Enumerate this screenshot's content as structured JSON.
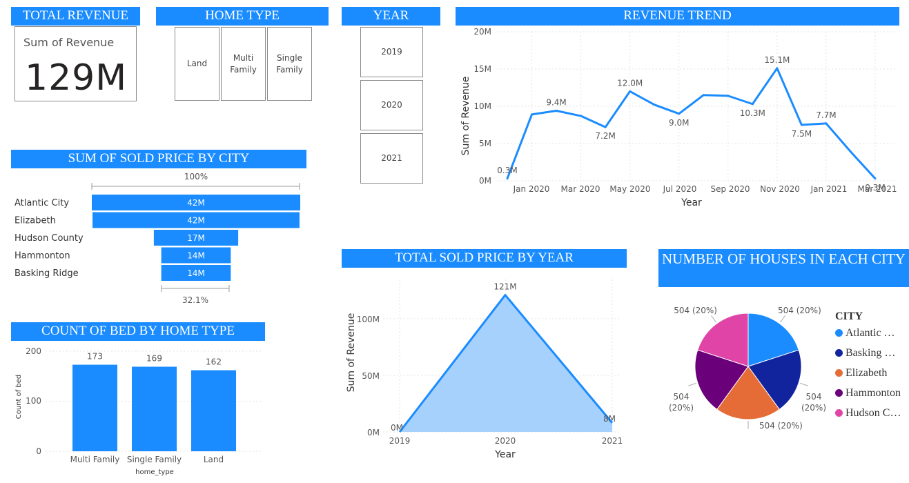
{
  "card": {
    "header": "TOTAL REVENUE",
    "label": "Sum of Revenue",
    "value": "129M"
  },
  "home_type": {
    "header": "HOME TYPE",
    "options": [
      "Land",
      "Multi Family",
      "Single Family"
    ]
  },
  "year_slicer": {
    "header": "YEAR",
    "options": [
      "2019",
      "2020",
      "2021"
    ]
  },
  "revenue_trend": {
    "header": "REVENUE TREND",
    "y_ticks": [
      "20M",
      "15M",
      "10M",
      "5M",
      "0M"
    ],
    "x_ticks": [
      "Jan 2020",
      "Mar 2020",
      "May 2020",
      "Jul 2020",
      "Sep 2020",
      "Nov 2020",
      "Jan 2021",
      "Mar 2021"
    ]
  },
  "funnel": {
    "header": "SUM OF SOLD PRICE BY CITY",
    "top_pct": "100%",
    "bottom_pct": "32.1%"
  },
  "bed_chart": {
    "header": "COUNT OF BED BY HOME TYPE",
    "y_ticks": [
      "200",
      "100",
      "0"
    ]
  },
  "sold_by_year": {
    "header": "TOTAL SOLD PRICE BY YEAR",
    "y_ticks": [
      "100M",
      "50M",
      "0M"
    ]
  },
  "houses_pie": {
    "header": "NUMBER OF HOUSES IN EACH CITY",
    "legend_title": "CITY",
    "legend": [
      "Atlantic …",
      "Basking …",
      "Elizabeth",
      "Hammonton",
      "Hudson C…"
    ]
  },
  "colors": {
    "header_bg": "#1a8cff",
    "accent": "#1a8cff",
    "area_fill": "#a6d1fc"
  },
  "chart_data": [
    {
      "type": "line",
      "title": "REVENUE TREND",
      "xlabel": "Year",
      "ylabel": "Sum of Revenue",
      "ylim": [
        0,
        20
      ],
      "unit": "M",
      "x": [
        "Dec 2019",
        "Jan 2020",
        "Feb 2020",
        "Mar 2020",
        "Apr 2020",
        "May 2020",
        "Jun 2020",
        "Jul 2020",
        "Aug 2020",
        "Sep 2020",
        "Oct 2020",
        "Nov 2020",
        "Dec 2020",
        "Jan 2021",
        "Feb 2021",
        "Mar 2021"
      ],
      "values": [
        0.3,
        8.9,
        9.4,
        8.7,
        7.2,
        12.0,
        10.2,
        9.0,
        11.5,
        11.4,
        10.3,
        15.1,
        7.5,
        7.7,
        3.9,
        0.3
      ],
      "data_labels": [
        {
          "index": 0,
          "text": "0.3M"
        },
        {
          "index": 2,
          "text": "9.4M"
        },
        {
          "index": 4,
          "text": "7.2M"
        },
        {
          "index": 5,
          "text": "12.0M"
        },
        {
          "index": 7,
          "text": "9.0M"
        },
        {
          "index": 10,
          "text": "10.3M"
        },
        {
          "index": 11,
          "text": "15.1M"
        },
        {
          "index": 12,
          "text": "7.5M"
        },
        {
          "index": 13,
          "text": "7.7M"
        },
        {
          "index": 15,
          "text": "0.3M"
        }
      ]
    },
    {
      "type": "bar",
      "subtype": "funnel",
      "title": "SUM OF SOLD PRICE BY CITY",
      "categories": [
        "Atlantic City",
        "Elizabeth",
        "Hudson County",
        "Hammonton",
        "Basking Ridge"
      ],
      "values": [
        42,
        42,
        17,
        14,
        14
      ],
      "labels": [
        "42M",
        "42M",
        "17M",
        "14M",
        "14M"
      ],
      "unit": "M"
    },
    {
      "type": "bar",
      "title": "COUNT OF BED BY HOME TYPE",
      "xlabel": "home_type",
      "ylabel": "Count of bed",
      "categories": [
        "Multi Family",
        "Single Family",
        "Land"
      ],
      "values": [
        173,
        169,
        162
      ],
      "ylim": [
        0,
        200
      ]
    },
    {
      "type": "area",
      "title": "TOTAL SOLD PRICE BY YEAR",
      "xlabel": "Year",
      "ylabel": "Sum of Revenue",
      "x": [
        "2019",
        "2020",
        "2021"
      ],
      "values": [
        0,
        121,
        8
      ],
      "labels": [
        "0M",
        "121M",
        "8M"
      ],
      "unit": "M",
      "ylim": [
        0,
        130
      ]
    },
    {
      "type": "pie",
      "title": "NUMBER OF HOUSES IN EACH CITY",
      "categories": [
        "Atlantic City",
        "Basking Ridge",
        "Elizabeth",
        "Hammonton",
        "Hudson County"
      ],
      "values": [
        504,
        504,
        504,
        504,
        504
      ],
      "labels": [
        "504 (20%)",
        "504 (20%)",
        "504 (20%)",
        "504 (20%)",
        "504 (20%)"
      ],
      "colors": [
        "#1a8cff",
        "#12239e",
        "#e66c37",
        "#6b007b",
        "#e044a7"
      ]
    }
  ]
}
